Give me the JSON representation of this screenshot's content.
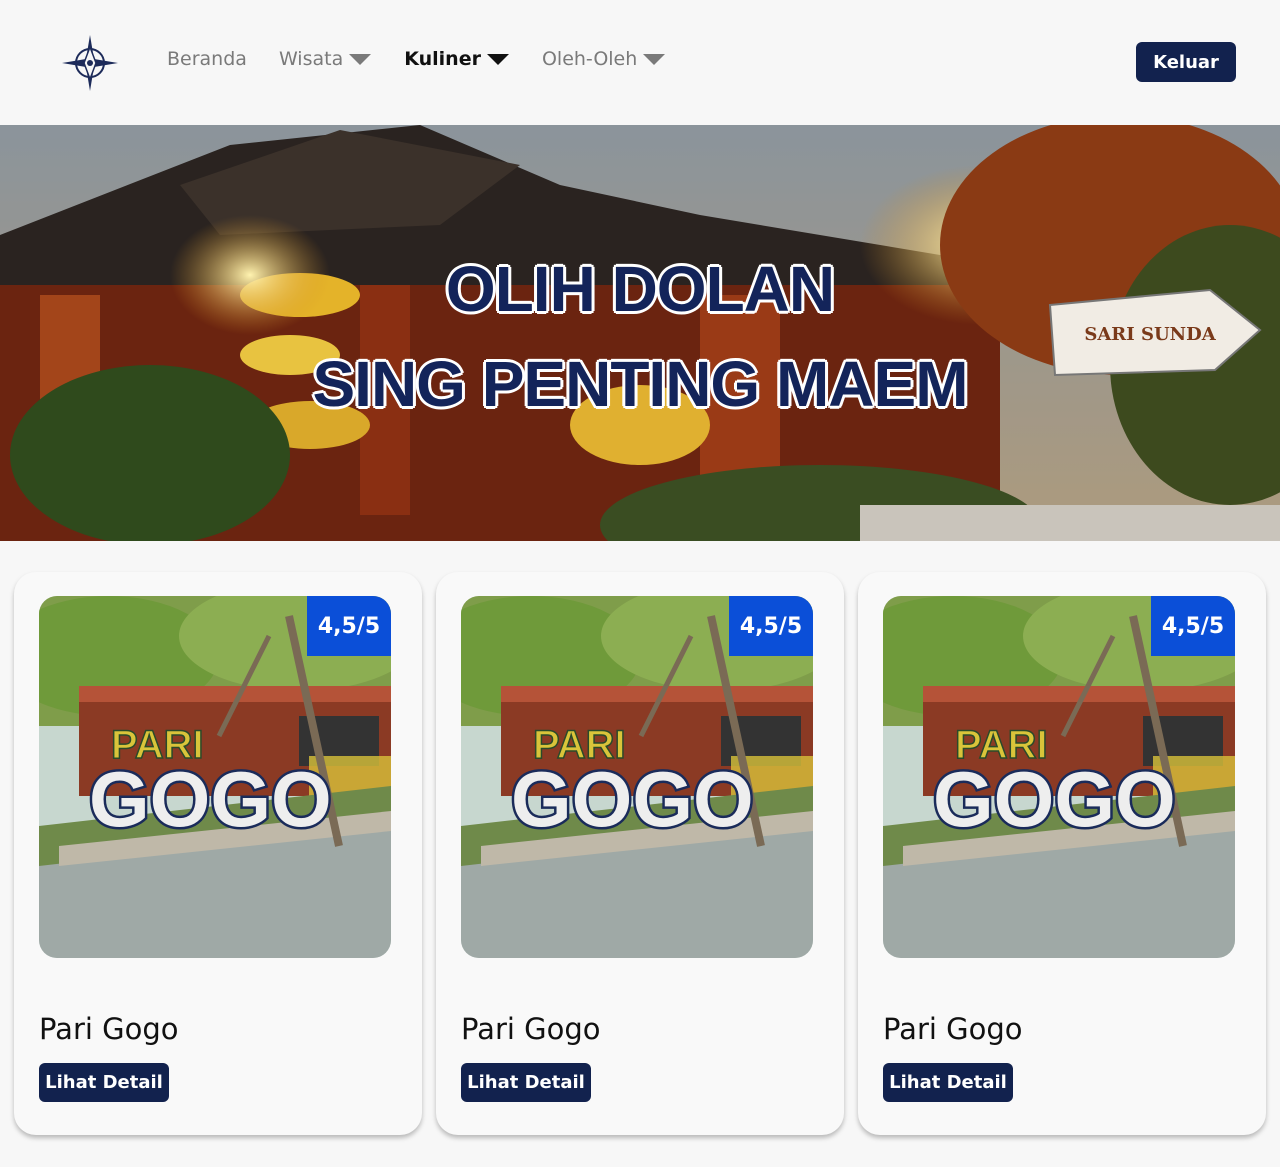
{
  "nav": {
    "logo_icon": "compass-logo-icon",
    "items": [
      {
        "label": "Beranda",
        "has_dropdown": false
      },
      {
        "label": "Wisata",
        "has_dropdown": true
      },
      {
        "label": "Kuliner",
        "has_dropdown": true,
        "active": true
      },
      {
        "label": "Oleh-Oleh",
        "has_dropdown": true
      }
    ],
    "logout_label": "Keluar"
  },
  "hero": {
    "line1": "OLIH DOLAN",
    "line2": "SING PENTING MAEM",
    "sign_text": "SARI SUNDA"
  },
  "cards": [
    {
      "rating": "4,5/5",
      "name": "Pari Gogo",
      "button": "Lihat Detail",
      "photo_sign_top": "PARI",
      "photo_sign_bottom": "GOGO"
    },
    {
      "rating": "4,5/5",
      "name": "Pari Gogo",
      "button": "Lihat Detail",
      "photo_sign_top": "PARI",
      "photo_sign_bottom": "GOGO"
    },
    {
      "rating": "4,5/5",
      "name": "Pari Gogo",
      "button": "Lihat Detail",
      "photo_sign_top": "PARI",
      "photo_sign_bottom": "GOGO"
    }
  ],
  "colors": {
    "brand_navy": "#12224e",
    "rating_blue": "#0b4fd8",
    "background": "#f7f7f7"
  }
}
